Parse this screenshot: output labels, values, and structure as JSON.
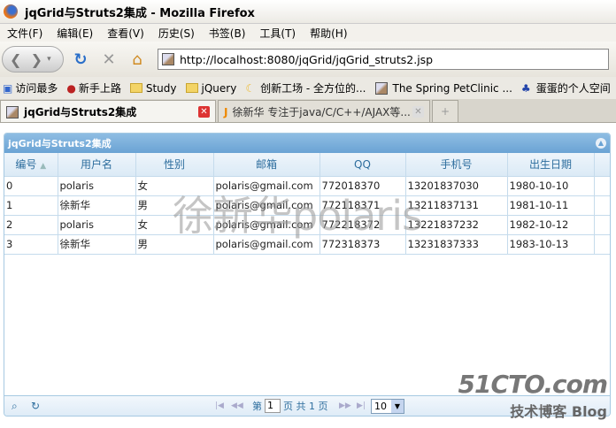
{
  "window": {
    "title": "jqGrid与Struts2集成 - Mozilla Firefox"
  },
  "menu": [
    "文件(F)",
    "编辑(E)",
    "查看(V)",
    "历史(S)",
    "书签(B)",
    "工具(T)",
    "帮助(H)"
  ],
  "nav": {
    "url": "http://localhost:8080/jqGrid/jqGrid_struts2.jsp"
  },
  "bookmarks": [
    "访问最多",
    "新手上路",
    "Study",
    "jQuery",
    "创新工场 - 全方位的...",
    "The Spring PetClinic ...",
    "蛋蛋的个人空间"
  ],
  "tabs": [
    {
      "label": "jqGrid与Struts2集成"
    },
    {
      "label": "徐新华 专注于java/C/C++/AJAX等..."
    }
  ],
  "grid": {
    "caption": "jqGrid与Struts2集成",
    "columns": [
      "编号",
      "用户名",
      "性别",
      "邮箱",
      "QQ",
      "手机号",
      "出生日期"
    ],
    "rows": [
      [
        "0",
        "polaris",
        "女",
        "polaris@gmail.com",
        "772018370",
        "13201837030",
        "1980-10-10"
      ],
      [
        "1",
        "徐新华",
        "男",
        "polaris@gmail.com",
        "772118371",
        "13211837131",
        "1981-10-11"
      ],
      [
        "2",
        "polaris",
        "女",
        "polaris@gmail.com",
        "772218372",
        "13221837232",
        "1982-10-12"
      ],
      [
        "3",
        "徐新华",
        "男",
        "polaris@gmail.com",
        "772318373",
        "13231837333",
        "1983-10-13"
      ]
    ],
    "pager": {
      "page_prefix": "第",
      "page": "1",
      "page_suffix": "页 共 1 页",
      "rows_per_page": "10"
    }
  },
  "watermark": "徐新华polaris",
  "site_watermark": {
    "logo": "51CTO.com",
    "sub": "技术博客 Blog"
  }
}
